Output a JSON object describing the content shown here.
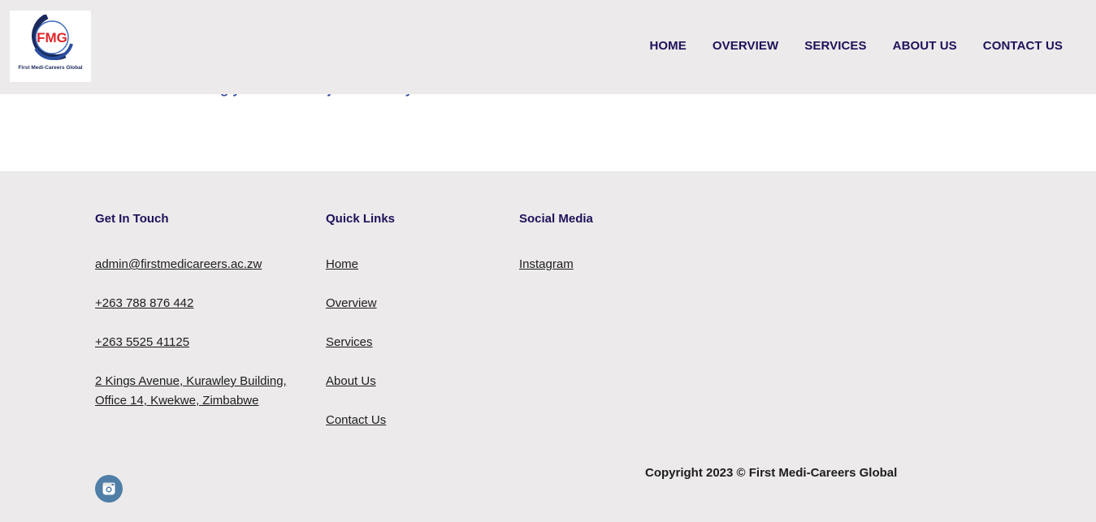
{
  "brand": {
    "logo_initials": "FMG",
    "logo_name": "First Medi-Careers Global",
    "colors": {
      "primary": "#1e1259",
      "logo_red": "#e0262a",
      "logo_blue": "#2a4fa0",
      "social_icon_bg": "#4f7ea6"
    }
  },
  "nav": {
    "items": [
      {
        "label": "HOME"
      },
      {
        "label": "OVERVIEW"
      },
      {
        "label": "SERVICES"
      },
      {
        "label": "ABOUT US"
      },
      {
        "label": "CONTACT US"
      }
    ]
  },
  "hero": {
    "peek_text": "back from achieving your dreams - join us today!"
  },
  "footer": {
    "contact": {
      "heading": "Get In Touch",
      "email": "admin@firstmedicareers.ac.zw",
      "phone1": "+263 788 876 442",
      "phone2": "+263 5525 41125",
      "address": "2 Kings Avenue, Kurawley Building, Office 14, Kwekwe, Zimbabwe"
    },
    "quick_links": {
      "heading": "Quick Links",
      "items": [
        {
          "label": "Home"
        },
        {
          "label": "Overview"
        },
        {
          "label": "Services"
        },
        {
          "label": "About Us"
        },
        {
          "label": "Contact Us"
        }
      ]
    },
    "social": {
      "heading": "Social Media",
      "items": [
        {
          "label": "Instagram",
          "icon": "instagram-icon"
        }
      ]
    },
    "copyright": "Copyright 2023 © First Medi-Careers Global"
  }
}
